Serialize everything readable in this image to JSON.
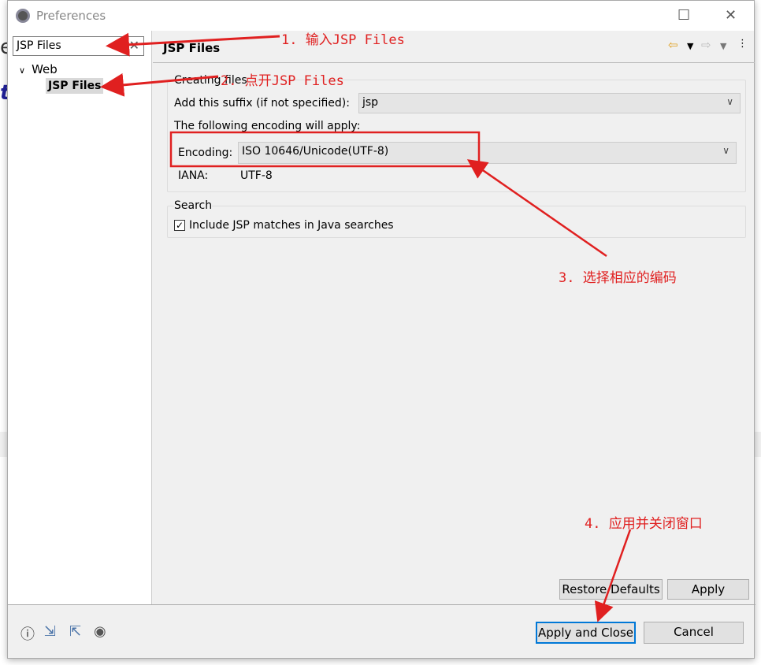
{
  "window": {
    "title": "Preferences",
    "maximize_icon": "square-icon",
    "close_icon": "x-icon"
  },
  "sidebar": {
    "filter_value": "JSP Files",
    "tree": [
      {
        "label": "Web",
        "expanded": true
      },
      {
        "label": "JSP Files",
        "selected": true
      }
    ]
  },
  "page": {
    "title": "JSP Files",
    "creating_files": {
      "label": "Creating files",
      "suffix_label": "Add this suffix (if not specified):",
      "suffix_value": "jsp",
      "encoding_intro": "The following encoding will apply:",
      "encoding_label": "Encoding:",
      "encoding_value": "ISO 10646/Unicode(UTF-8)",
      "iana_label": "IANA:",
      "iana_value": "UTF-8"
    },
    "search": {
      "label": "Search",
      "include_label": "Include JSP matches in Java searches",
      "include_checked": true
    }
  },
  "buttons": {
    "restore_defaults": "Restore Defaults",
    "apply": "Apply",
    "apply_and_close": "Apply and Close",
    "cancel": "Cancel"
  },
  "annotations": [
    "1. 输入JSP Files",
    "2. 点开JSP Files",
    "3. 选择相应的编码",
    "4. 应用并关闭窗口"
  ],
  "colors": {
    "annotation": "#e02020",
    "default_button_border": "#0078d7"
  }
}
